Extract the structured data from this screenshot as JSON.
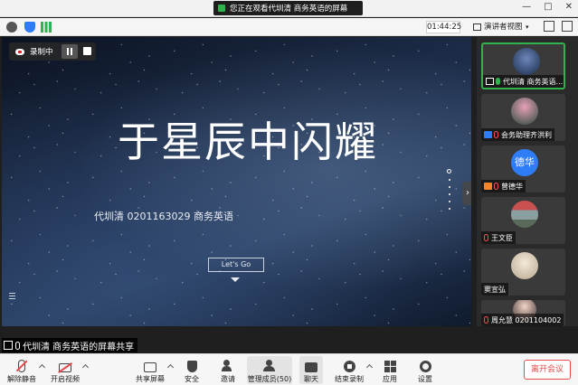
{
  "window": {
    "share_banner": "您正在观看代圳清 商务英语的屏幕",
    "ctrl_min": "—",
    "ctrl_max": "□",
    "ctrl_close": "✕"
  },
  "infobar": {
    "timer": "01:44:25",
    "view_label": "演讲者视图"
  },
  "recording": {
    "label": "录制中"
  },
  "slide": {
    "title": "于星辰中闪耀",
    "subtitle": "代圳清 0201163029 商务英语",
    "button": "Let's Go"
  },
  "share_label": "代圳清 商务英语的屏幕共享",
  "gallery": [
    {
      "name": "代圳清 商务英语...",
      "badge": "screen",
      "mic": "green",
      "active": true,
      "avatar_text": ""
    },
    {
      "name": "会务助理齐洪利",
      "badge": "host",
      "mic": "muted",
      "active": false,
      "avatar_text": ""
    },
    {
      "name": "曾德华",
      "badge": "cohost",
      "mic": "muted",
      "active": false,
      "avatar_text": "德华"
    },
    {
      "name": "王文臣",
      "badge": "",
      "mic": "muted",
      "active": false,
      "avatar_text": ""
    },
    {
      "name": "窦宣弘",
      "badge": "",
      "mic": "",
      "active": false,
      "avatar_text": ""
    },
    {
      "name": "周允慧 0201104002",
      "badge": "",
      "mic": "muted",
      "active": false,
      "avatar_text": ""
    }
  ],
  "toolbar": {
    "unmute": "解除静音",
    "start_video": "开启视频",
    "share_screen": "共享屏幕",
    "security": "安全",
    "invite": "邀请",
    "members": "管理成员(50)",
    "chat": "聊天",
    "end_record": "结束录制",
    "apps": "应用",
    "settings": "设置",
    "leave": "离开会议"
  }
}
